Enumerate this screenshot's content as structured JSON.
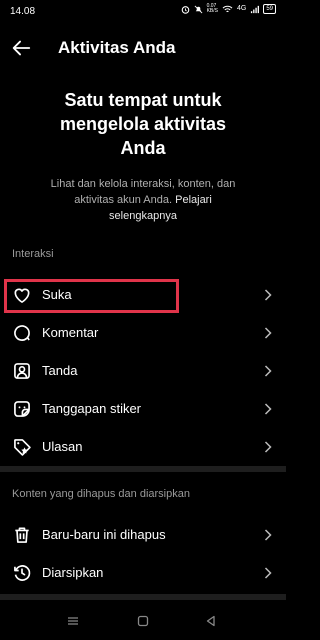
{
  "status_bar": {
    "time": "14.08",
    "network_speed": "0.07\nKB/S",
    "signal": "4G",
    "battery": "59"
  },
  "header": {
    "title": "Aktivitas Anda"
  },
  "hero": {
    "line1": "Satu tempat untuk",
    "line2": "mengelola aktivitas",
    "line3": "Anda",
    "description": "Lihat dan kelola interaksi, konten, dan aktivitas akun Anda.",
    "link_text": "Pelajari selengkapnya"
  },
  "interactions": {
    "section_label": "Interaksi",
    "items": [
      {
        "label": "Suka",
        "icon": "heart-icon"
      },
      {
        "label": "Komentar",
        "icon": "comment-icon"
      },
      {
        "label": "Tanda",
        "icon": "tag-person-icon"
      },
      {
        "label": "Tanggapan stiker",
        "icon": "sticker-icon"
      },
      {
        "label": "Ulasan",
        "icon": "review-tag-icon"
      }
    ]
  },
  "deleted_archived": {
    "section_label": "Konten yang dihapus dan diarsipkan",
    "items": [
      {
        "label": "Baru-baru ini dihapus",
        "icon": "trash-icon"
      },
      {
        "label": "Diarsipkan",
        "icon": "archive-history-icon"
      }
    ]
  },
  "colors": {
    "background": "#000000",
    "highlight": "#e0344a",
    "divider": "#1e1e1e",
    "muted_text": "#b0b0b0"
  }
}
